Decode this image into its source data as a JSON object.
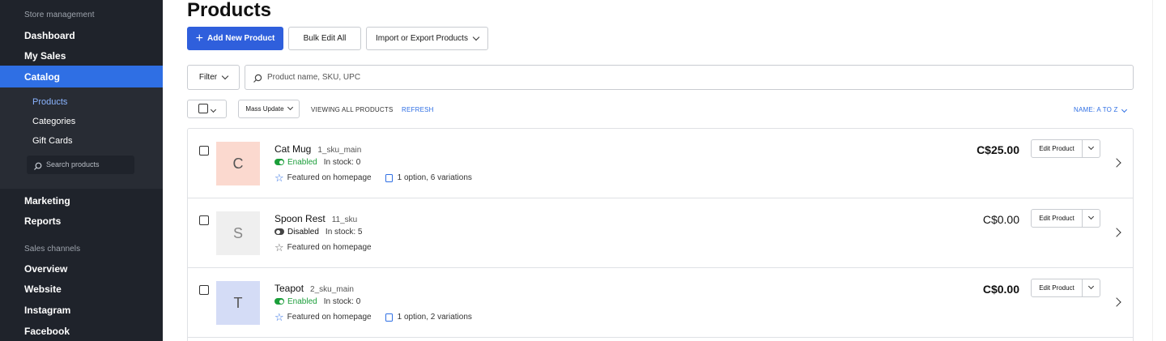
{
  "sidebar": {
    "section_store": "Store management",
    "items_top": [
      "Dashboard",
      "My Sales"
    ],
    "active": "Catalog",
    "sub_items": [
      "Products",
      "Categories",
      "Gift Cards"
    ],
    "search_placeholder": "Search products",
    "items_mid": [
      "Marketing",
      "Reports"
    ],
    "section_channels": "Sales channels",
    "channels": [
      "Overview",
      "Website",
      "Instagram",
      "Facebook"
    ]
  },
  "main": {
    "title": "Products",
    "add_button": "Add New Product",
    "bulk_button": "Bulk Edit All",
    "import_button": "Import or Export Products",
    "filter_label": "Filter",
    "search_placeholder": "Product name, SKU, UPC",
    "mass_update": "Mass Update",
    "viewing": "VIEWING ALL PRODUCTS",
    "refresh": "REFRESH",
    "sort": "NAME: A TO Z"
  },
  "products": [
    {
      "initial": "C",
      "name": "Cat Mug",
      "sku": "1_sku_main",
      "status": "Enabled",
      "stock": "In stock: 0",
      "featured": "Featured on homepage",
      "options": "1 option, 6 variations",
      "price": "C$25.00",
      "edit": "Edit Product",
      "thumb_color": "#fbd9cf"
    },
    {
      "initial": "S",
      "name": "Spoon Rest",
      "sku": "11_sku",
      "status": "Disabled",
      "stock": "In stock: 5",
      "featured": "Featured on homepage",
      "options": "",
      "price": "C$0.00",
      "edit": "Edit Product",
      "thumb_color": "#efefef"
    },
    {
      "initial": "T",
      "name": "Teapot",
      "sku": "2_sku_main",
      "status": "Enabled",
      "stock": "In stock: 0",
      "featured": "Featured on homepage",
      "options": "1 option, 2 variations",
      "price": "C$0.00",
      "edit": "Edit Product",
      "thumb_color": "#d4dcf6"
    }
  ],
  "colors": {
    "accent": "#2f6fe4",
    "sidebar_bg": "#1f232b",
    "enabled": "#1b9e3a"
  }
}
